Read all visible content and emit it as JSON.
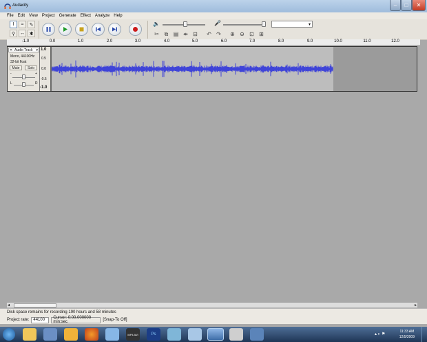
{
  "window": {
    "title": "Audacity",
    "buttons": [
      "–",
      "□",
      "✕"
    ]
  },
  "menu": [
    "File",
    "Edit",
    "View",
    "Project",
    "Generate",
    "Effect",
    "Analyze",
    "Help"
  ],
  "ruler": {
    "ticks": [
      "-1.0",
      "0.0",
      "1.0",
      "2.0",
      "3.0",
      "4.0",
      "5.0",
      "6.0",
      "7.0",
      "8.0",
      "9.0",
      "10.0",
      "11.0",
      "12.0"
    ]
  },
  "track": {
    "name": "Audio Track",
    "close": "✕",
    "info1": "Mono, 44100Hz",
    "info2": "32-bit float",
    "mute": "Mute",
    "solo": "Solo",
    "gain_minus": "-",
    "gain_plus": "+",
    "pan_left": "L",
    "pan_right": "R",
    "scale": [
      "1.0",
      "0.5",
      "0.0",
      "-0.5",
      "-1.0"
    ]
  },
  "status": {
    "disk": "Disk space remains for recording 190 hours and 58 minutes",
    "project_rate_label": "Project rate:",
    "project_rate": "44100",
    "cursor": "Cursor: 0:00.000000 min:sec",
    "snap": "[Snap-To Off]"
  },
  "taskbar": {
    "items": [
      "",
      "",
      "",
      "",
      "",
      "",
      "MP4 AVI",
      "Ps",
      "",
      "",
      "",
      "",
      ""
    ],
    "time": "11:33 AM",
    "date": "12/5/2009"
  }
}
